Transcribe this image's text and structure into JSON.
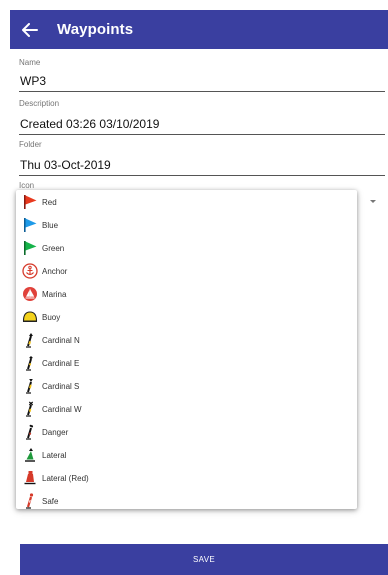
{
  "appbar": {
    "title": "Waypoints",
    "back_icon": "back-arrow-icon"
  },
  "form": {
    "name": {
      "label": "Name",
      "value": "WP3"
    },
    "description": {
      "label": "Description",
      "value": "Created 03:26 03/10/2019"
    },
    "folder": {
      "label": "Folder",
      "value": "Thu 03-Oct-2019"
    },
    "icon": {
      "label": "Icon"
    }
  },
  "icon_options": [
    {
      "label": "Red",
      "icon": "red-flag-icon"
    },
    {
      "label": "Blue",
      "icon": "blue-flag-icon"
    },
    {
      "label": "Green",
      "icon": "green-flag-icon"
    },
    {
      "label": "Anchor",
      "icon": "anchor-icon"
    },
    {
      "label": "Marina",
      "icon": "marina-icon"
    },
    {
      "label": "Buoy",
      "icon": "buoy-icon"
    },
    {
      "label": "Cardinal N",
      "icon": "cardinal-n-icon"
    },
    {
      "label": "Cardinal E",
      "icon": "cardinal-e-icon"
    },
    {
      "label": "Cardinal S",
      "icon": "cardinal-s-icon"
    },
    {
      "label": "Cardinal W",
      "icon": "cardinal-w-icon"
    },
    {
      "label": "Danger",
      "icon": "danger-icon"
    },
    {
      "label": "Lateral",
      "icon": "lateral-icon"
    },
    {
      "label": "Lateral (Red)",
      "icon": "lateral-red-icon"
    },
    {
      "label": "Safe",
      "icon": "safe-icon"
    }
  ],
  "save_label": "SAVE",
  "colors": {
    "primary": "#3a3fa0",
    "red_flag": "#e8391e",
    "blue_flag": "#1e9ae8",
    "green_flag": "#16b34a"
  }
}
